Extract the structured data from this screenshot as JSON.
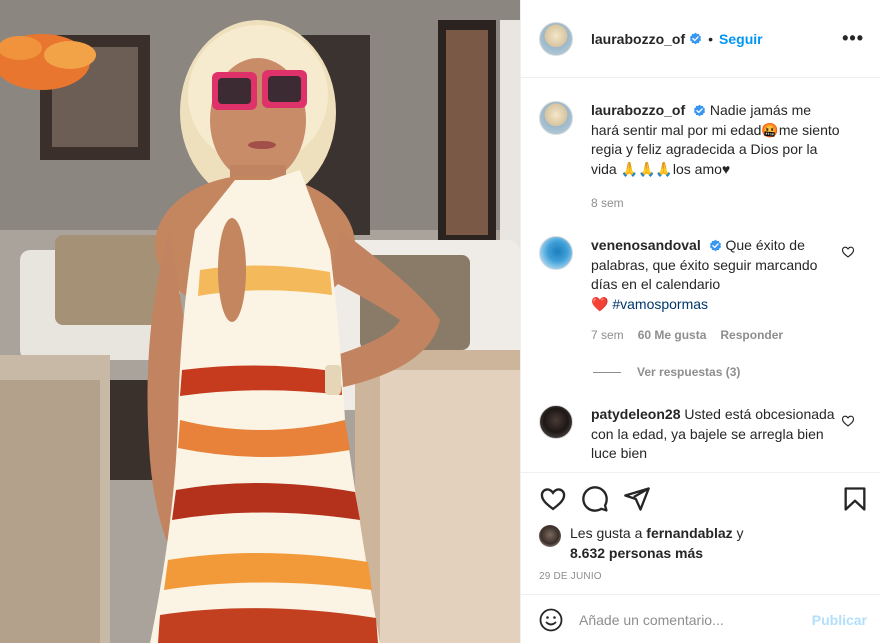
{
  "post": {
    "username": "laurabozzo_of",
    "follow_label": "Seguir",
    "separator": "•",
    "more_label": "•••"
  },
  "caption": {
    "username": "laurabozzo_of",
    "text": "Nadie jamás me hará sentir mal por mi edad🤬me siento regia y feliz agradecida a Dios por la vida 🙏🙏🙏los amo♥",
    "time": "8 sem"
  },
  "comments": [
    {
      "username": "venenosandoval",
      "text": "Que éxito de palabras, que éxito seguir marcando días en el calendario",
      "emoji": "❤️",
      "hashtag": "#vamospormas",
      "time": "7 sem",
      "likes": "60 Me gusta",
      "reply_label": "Responder",
      "view_replies": "Ver respuestas (3)"
    },
    {
      "username": "patydeleon28",
      "text": "Usted está obcesionada con la edad, ya bajele se arregla bien luce bien"
    }
  ],
  "likes": {
    "prefix": "Les gusta a",
    "first_user": "fernandablaz",
    "connector": "y",
    "others": "8.632 personas más"
  },
  "date": "29 DE JUNIO",
  "comment_box": {
    "placeholder": "Añade un comentario...",
    "publish_label": "Publicar"
  },
  "icons": {
    "verified": "verified-badge-icon",
    "heart": "heart-icon",
    "comment": "comment-icon",
    "share": "share-icon",
    "save": "bookmark-icon",
    "emoji": "emoji-icon"
  },
  "colors": {
    "accent": "#0095f6",
    "text": "#262626",
    "muted": "#8e8e8e",
    "publish_disabled": "#b2dffc",
    "heart_red": "#ed4956"
  }
}
